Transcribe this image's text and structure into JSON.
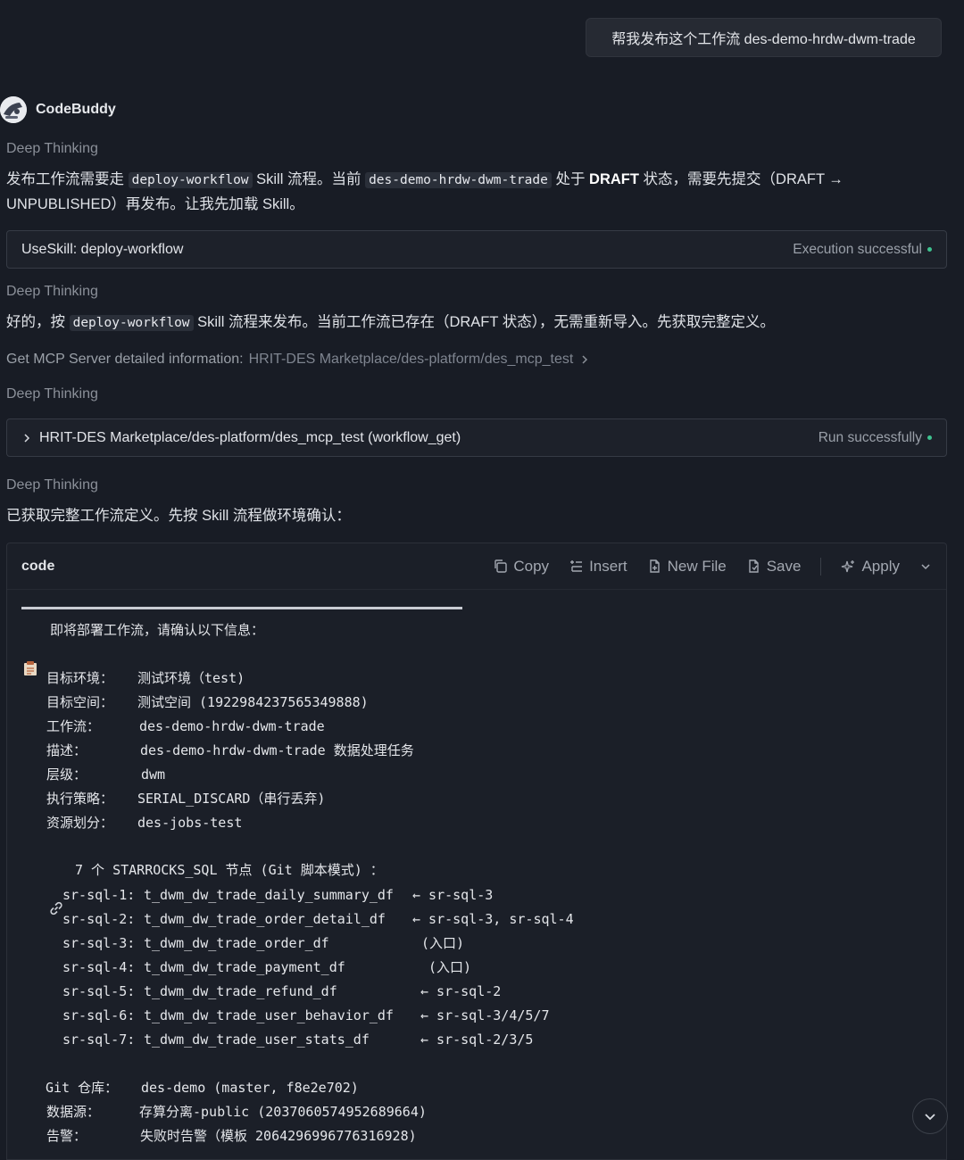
{
  "user_message": "帮我发布这个工作流 des-demo-hrdw-dwm-trade",
  "assistant": {
    "name": "CodeBuddy"
  },
  "thinking_label": "Deep Thinking",
  "para1": {
    "t1": "发布工作流需要走 ",
    "code1": "deploy-workflow",
    "t2": " Skill 流程。当前 ",
    "code2": "des-demo-hrdw-dwm-trade",
    "t3": " 处于 ",
    "bold": "DRAFT",
    "t4": " 状态，需要先提交（DRAFT → UNPUBLISHED）再发布。让我先加载 Skill。"
  },
  "tool1": {
    "title": "UseSkill: deploy-workflow",
    "status": "Execution successful"
  },
  "para2": {
    "t1": "好的，按 ",
    "code1": "deploy-workflow",
    "t2": " Skill 流程来发布。当前工作流已存在（DRAFT 状态），无需重新导入。先获取完整定义。"
  },
  "mcp_info": {
    "label": "Get MCP Server detailed information:",
    "path": "HRIT-DES Marketplace/des-platform/des_mcp_test"
  },
  "tool2": {
    "title": "HRIT-DES Marketplace/des-platform/des_mcp_test (workflow_get)",
    "status": "Run successfully"
  },
  "para3": "已获取完整工作流定义。先按 Skill 流程做环境确认：",
  "code_block": {
    "lang": "code",
    "actions": {
      "copy": "Copy",
      "insert": "Insert",
      "new_file": "New File",
      "save": "Save",
      "apply": "Apply"
    },
    "header": "即将部署工作流，请确认以下信息：",
    "info": [
      {
        "k": "目标环境：",
        "v": "测试环境（test)"
      },
      {
        "k": "目标空间：",
        "v": "测试空间 (1922984237565349888)"
      },
      {
        "k": "工作流：",
        "v": "des-demo-hrdw-dwm-trade"
      },
      {
        "k": "描述：",
        "v": "des-demo-hrdw-dwm-trade 数据处理任务"
      },
      {
        "k": "层级：",
        "v": "dwm"
      },
      {
        "k": "执行策略：",
        "v": "SERIAL_DISCARD（串行丢弃)"
      },
      {
        "k": "资源划分：",
        "v": "des-jobs-test"
      }
    ],
    "nodes_header": "7 个 STARROCKS_SQL 节点 (Git 脚本模式) ：",
    "nodes": [
      {
        "id": "sr-sql-1:",
        "table": "t_dwm_dw_trade_daily_summary_df",
        "dep": "← sr-sql-3"
      },
      {
        "id": "sr-sql-2:",
        "table": "t_dwm_dw_trade_order_detail_df",
        "dep": "← sr-sql-3, sr-sql-4"
      },
      {
        "id": "sr-sql-3:",
        "table": "t_dwm_dw_trade_order_df",
        "dep": "(入口)"
      },
      {
        "id": "sr-sql-4:",
        "table": "t_dwm_dw_trade_payment_df",
        "dep": "(入口)"
      },
      {
        "id": "sr-sql-5:",
        "table": "t_dwm_dw_trade_refund_df",
        "dep": "← sr-sql-2"
      },
      {
        "id": "sr-sql-6:",
        "table": "t_dwm_dw_trade_user_behavior_df",
        "dep": "← sr-sql-3/4/5/7"
      },
      {
        "id": "sr-sql-7:",
        "table": "t_dwm_dw_trade_user_stats_df",
        "dep": "← sr-sql-2/3/5"
      }
    ],
    "footer": [
      {
        "k": "Git 仓库：",
        "v": "des-demo (master, f8e2e702)"
      },
      {
        "k": "数据源：",
        "v": "存算分离-public (2037060574952689664)"
      },
      {
        "k": "告警：",
        "v": "失败时告警（模板 2064296996776316928)"
      }
    ]
  }
}
